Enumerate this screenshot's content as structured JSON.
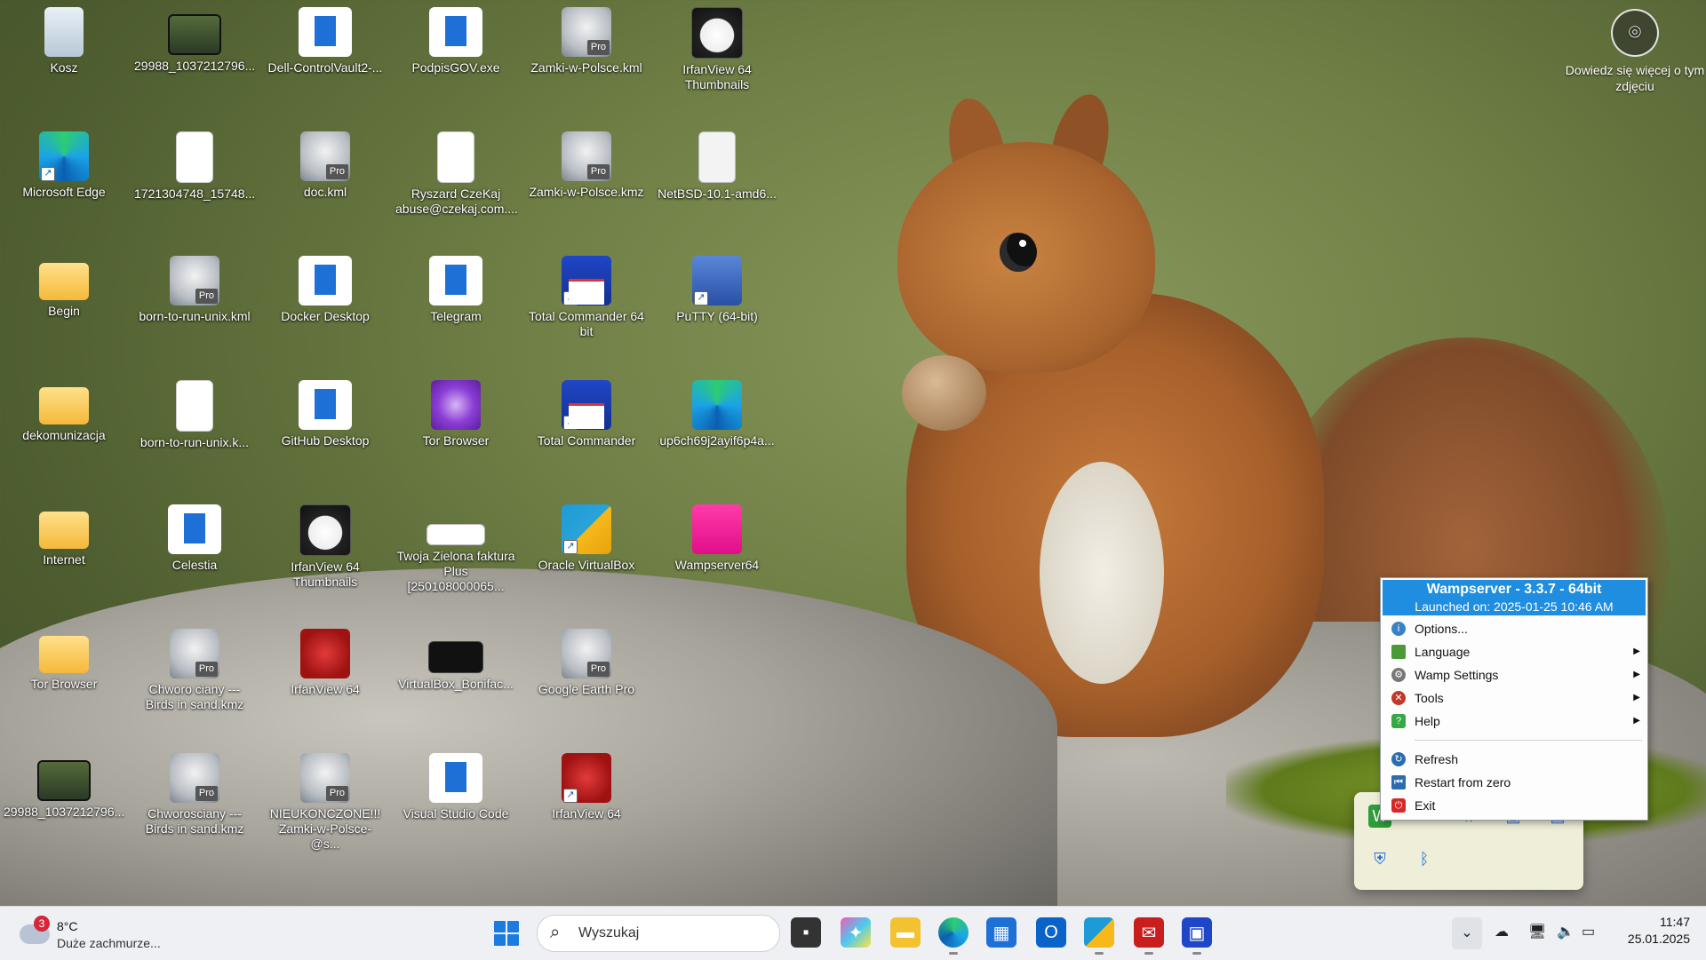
{
  "desktop": {
    "icons": [
      {
        "label": "Kosz"
      },
      {
        "label": "29988_1037212796..."
      },
      {
        "label": "Dell-ControlVault2-..."
      },
      {
        "label": "PodpisGOV.exe"
      },
      {
        "label": "Zamki-w-Polsce.kml"
      },
      {
        "label": "IrfanView 64 Thumbnails"
      },
      {
        "label": "Microsoft Edge"
      },
      {
        "label": "1721304748_15748..."
      },
      {
        "label": "doc.kml"
      },
      {
        "label": "Ryszard CzeKaj abuse@czekaj.com...."
      },
      {
        "label": "Zamki-w-Polsce.kmz"
      },
      {
        "label": "NetBSD-10.1-amd6..."
      },
      {
        "label": "Begin"
      },
      {
        "label": "born-to-run-unix.kml"
      },
      {
        "label": "Docker Desktop"
      },
      {
        "label": "Telegram"
      },
      {
        "label": "Total Commander 64 bit"
      },
      {
        "label": "PuTTY (64-bit)"
      },
      {
        "label": "dekomunizacja"
      },
      {
        "label": "born-to-run-unix.k..."
      },
      {
        "label": "GitHub Desktop"
      },
      {
        "label": "Tor Browser"
      },
      {
        "label": "Total Commander"
      },
      {
        "label": "up6ch69j2ayif6p4a..."
      },
      {
        "label": "Internet"
      },
      {
        "label": "Celestia"
      },
      {
        "label": "IrfanView 64 Thumbnails"
      },
      {
        "label": "Twoja Zielona faktura Plus [250108000065..."
      },
      {
        "label": "Oracle VirtualBox"
      },
      {
        "label": "Wampserver64"
      },
      {
        "label": "Tor Browser"
      },
      {
        "label": "Chworo ciany --- Birds in sand.kmz"
      },
      {
        "label": "IrfanView 64"
      },
      {
        "label": "VirtualBox_Bonifac..."
      },
      {
        "label": "Google Earth Pro"
      },
      {
        "label": "29988_1037212796..."
      },
      {
        "label": "Chworosciany --- Birds in sand.kmz"
      },
      {
        "label": "NIEUKONCZONE!!! Zamki-w-Polsce-@s..."
      },
      {
        "label": "Visual Studio Code"
      },
      {
        "label": "IrfanView 64"
      }
    ],
    "info": {
      "label": "Dowiedz się więcej o tym zdjęciu"
    }
  },
  "wamp_menu": {
    "title": "Wampserver - 3.3.7 - 64bit",
    "launched": "Launched on:  2025-01-25 10:46 AM",
    "items": [
      {
        "label": "Options...",
        "color": "#3b82c4",
        "submenu": false
      },
      {
        "label": "Language",
        "color": "#4a9a3a",
        "submenu": true
      },
      {
        "label": "Wamp Settings",
        "color": "#777777",
        "submenu": true
      },
      {
        "label": "Tools",
        "color": "#c0392b",
        "submenu": true
      },
      {
        "label": "Help",
        "color": "#36a845",
        "submenu": true
      }
    ],
    "items2": [
      {
        "label": "Refresh",
        "color": "#2b6cb0"
      },
      {
        "label": "Restart from zero",
        "color": "#2b6cb0"
      },
      {
        "label": "Exit",
        "color": "#d62828"
      }
    ]
  },
  "taskbar": {
    "weather": {
      "badge": "3",
      "temp": "8°C",
      "condition": "Duże zachmurze..."
    },
    "search_placeholder": "Wyszukaj",
    "clock": {
      "time": "11:47",
      "date": "25.01.2025"
    }
  }
}
